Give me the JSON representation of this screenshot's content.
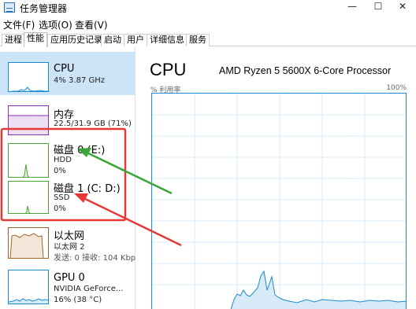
{
  "window": {
    "title": "任务管理器",
    "minimize_glyph": "—",
    "maximize_glyph": "☐",
    "close_glyph": "✕"
  },
  "menu": {
    "file": "文件(F)",
    "options": "选项(O)",
    "view": "查看(V)"
  },
  "tabs": [
    {
      "label": "进程"
    },
    {
      "label": "性能",
      "active": true
    },
    {
      "label": "应用历史记录"
    },
    {
      "label": "启动"
    },
    {
      "label": "用户"
    },
    {
      "label": "详细信息"
    },
    {
      "label": "服务"
    }
  ],
  "sidebar": {
    "items": [
      {
        "title": "CPU",
        "lines": [
          "4% 3.87 GHz"
        ],
        "color": "#1b8ad0",
        "selected": true
      },
      {
        "title": "内存",
        "lines": [
          "22.5/31.9 GB (71%)"
        ],
        "color": "#8b2fb0"
      },
      {
        "title": "磁盘 0 (E:)",
        "lines": [
          "HDD",
          "0%"
        ],
        "color": "#4da33c"
      },
      {
        "title": "磁盘 1 (C: D:)",
        "lines": [
          "SSD",
          "0%"
        ],
        "color": "#4da33c"
      },
      {
        "title": "以太网",
        "lines": [
          "以太网 2",
          "发送: 0 接收: 104 Kbp"
        ],
        "color": "#a0642a"
      },
      {
        "title": "GPU 0",
        "lines": [
          "NVIDIA GeForce...",
          "16% (38 °C)"
        ],
        "color": "#1b8ad0"
      }
    ]
  },
  "main": {
    "title": "CPU",
    "processor": "AMD Ryzen 5 5600X 6-Core Processor",
    "util_label": "% 利用率",
    "util_max": "100%"
  },
  "colors": {
    "cpu": "#1b8ad0",
    "memory": "#8b2fb0",
    "disk": "#4da33c",
    "ethernet": "#a0642a",
    "highlight_box": "#e53935",
    "green_arrow": "#3aa63a",
    "red_arrow": "#e53935",
    "selected_bg": "#cce4f7"
  },
  "icons": {
    "app": "task-manager-icon"
  }
}
